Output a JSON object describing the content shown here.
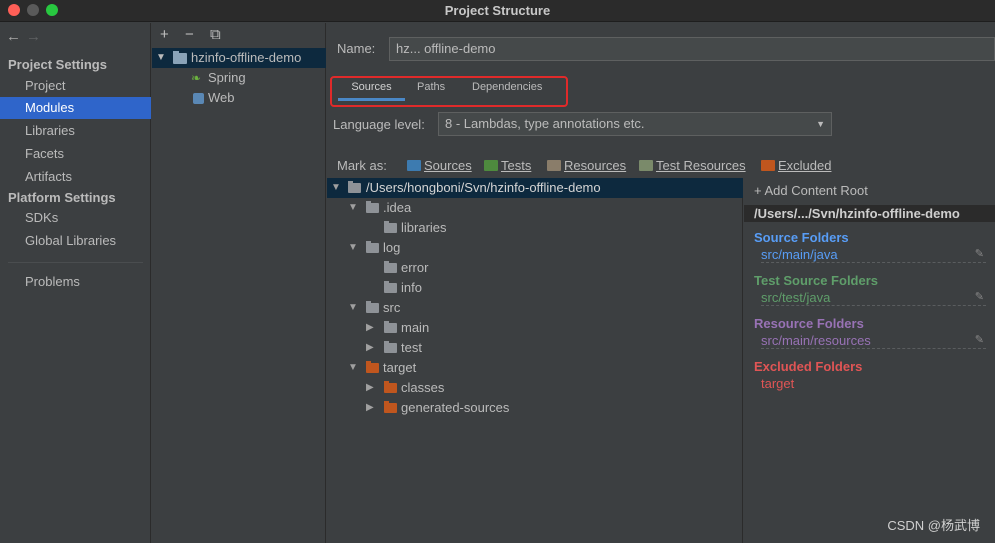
{
  "window": {
    "title": "Project Structure"
  },
  "sidebar": {
    "back": "←",
    "forward": "→",
    "project_settings": "Project Settings",
    "platform_settings": "Platform Settings",
    "items": [
      {
        "label": "Project"
      },
      {
        "label": "Modules"
      },
      {
        "label": "Libraries"
      },
      {
        "label": "Facets"
      },
      {
        "label": "Artifacts"
      },
      {
        "label": "SDKs"
      },
      {
        "label": "Global Libraries"
      },
      {
        "label": "Problems"
      }
    ]
  },
  "modules": {
    "add": "+",
    "remove": "−",
    "copy": "⧉",
    "items": [
      {
        "label": "hzinfo-offline-demo"
      },
      {
        "label": "Spring"
      },
      {
        "label": "Web"
      }
    ]
  },
  "main": {
    "name_label": "Name:",
    "name_value": "hz...  offline-demo",
    "tabs": [
      {
        "label": "Sources"
      },
      {
        "label": "Paths"
      },
      {
        "label": "Dependencies"
      }
    ],
    "language_label": "Language level:",
    "language_value": "8 - Lambdas, type annotations etc.",
    "mark_as": "Mark as:",
    "marks": [
      {
        "label": "Sources",
        "color": "#3d7bb0"
      },
      {
        "label": "Tests",
        "color": "#4e8a3e"
      },
      {
        "label": "Resources",
        "color": "#8a7d6a"
      },
      {
        "label": "Test Resources",
        "color": "#7a8a6a"
      },
      {
        "label": "Excluded",
        "color": "#c0561e"
      }
    ]
  },
  "tree": [
    {
      "label": "/Users/hongboni/Svn/hzinfo-offline-demo"
    },
    {
      "label": ".idea"
    },
    {
      "label": "libraries"
    },
    {
      "label": "log"
    },
    {
      "label": "error"
    },
    {
      "label": "info"
    },
    {
      "label": "src"
    },
    {
      "label": "main"
    },
    {
      "label": "test"
    },
    {
      "label": "target"
    },
    {
      "label": "classes"
    },
    {
      "label": "generated-sources"
    }
  ],
  "content_root": {
    "add_label": "+ Add Content Root",
    "path": "/Users/.../Svn/hzinfo-offline-demo",
    "source_head": "Source Folders",
    "source_path": "src/main/java",
    "test_head": "Test Source Folders",
    "test_path": "src/test/java",
    "resource_head": "Resource Folders",
    "resource_path": "src/main/resources",
    "excluded_head": "Excluded Folders",
    "excluded_path": "target",
    "colors": {
      "source": "#589df6",
      "test": "#5f9e6a",
      "resource": "#9872b5",
      "excluded": "#e05555"
    }
  },
  "watermark": "CSDN @杨武博"
}
